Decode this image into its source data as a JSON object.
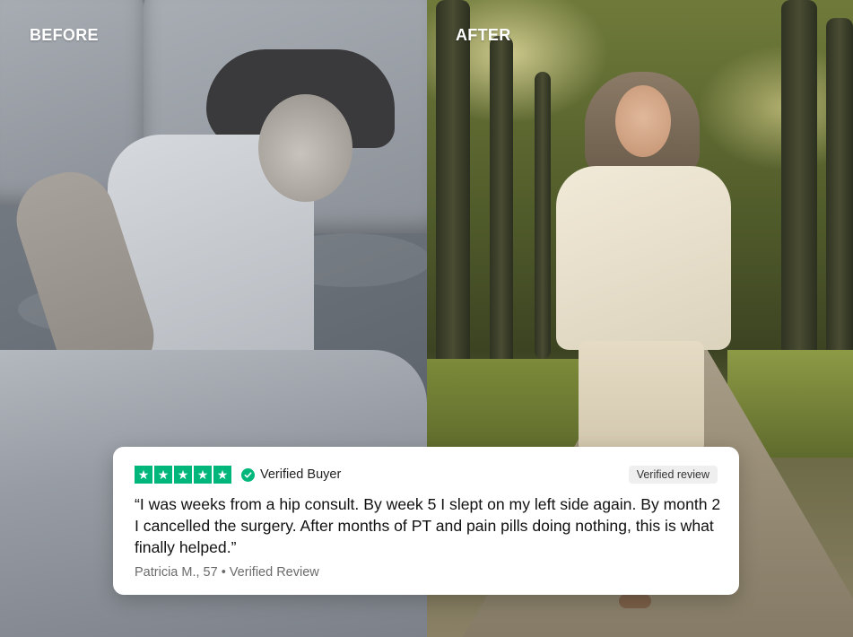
{
  "labels": {
    "before": "BEFORE",
    "after": "AFTER"
  },
  "review": {
    "rating": 5,
    "star_icon": "star-icon",
    "verified_icon": "check-circle-icon",
    "verified_buyer": "Verified Buyer",
    "badge": "Verified review",
    "quote": "“I was weeks from a hip consult. By week 5 I slept on my left side again. By month 2 I cancelled the surgery. After months of PT and pain pills doing nothing, this is what finally helped.”",
    "reviewer": "Patricia M., 57 • Verified Review"
  },
  "colors": {
    "star_green": "#00b67a",
    "card_bg": "#ffffff",
    "label_text": "#ffffff"
  }
}
